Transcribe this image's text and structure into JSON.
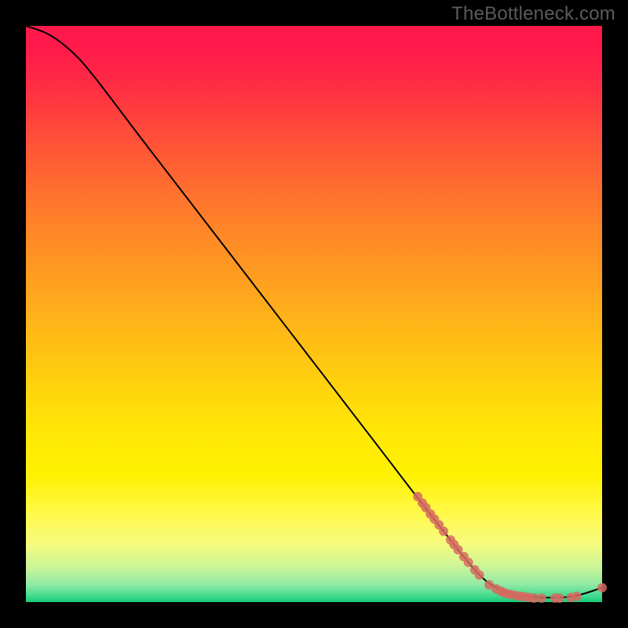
{
  "watermark": "TheBottleneck.com",
  "colors": {
    "background": "#000000",
    "curve_stroke": "#000000",
    "marker_fill": "#d66a60",
    "marker_stroke": "#d66a60",
    "gradient_top": "#ff1a4b",
    "gradient_bottom": "#15c97a"
  },
  "chart_data": {
    "type": "line",
    "title": "",
    "xlabel": "",
    "ylabel": "",
    "x_range": [
      0,
      100
    ],
    "y_range": [
      0,
      100
    ],
    "grid": false,
    "legend": false,
    "curve": [
      {
        "x": 0,
        "y": 100
      },
      {
        "x": 4,
        "y": 98.5
      },
      {
        "x": 8,
        "y": 95.5
      },
      {
        "x": 12,
        "y": 91
      },
      {
        "x": 20,
        "y": 80.5
      },
      {
        "x": 30,
        "y": 67.5
      },
      {
        "x": 40,
        "y": 54.5
      },
      {
        "x": 50,
        "y": 41.5
      },
      {
        "x": 60,
        "y": 28.5
      },
      {
        "x": 70,
        "y": 15.5
      },
      {
        "x": 78,
        "y": 5.5
      },
      {
        "x": 82,
        "y": 2.3
      },
      {
        "x": 85,
        "y": 1.2
      },
      {
        "x": 90,
        "y": 0.8
      },
      {
        "x": 95,
        "y": 1.0
      },
      {
        "x": 100,
        "y": 2.5
      }
    ],
    "markers": [
      {
        "x": 68.0,
        "y": 18.3
      },
      {
        "x": 68.8,
        "y": 17.2
      },
      {
        "x": 69.4,
        "y": 16.4
      },
      {
        "x": 70.2,
        "y": 15.3
      },
      {
        "x": 70.9,
        "y": 14.4
      },
      {
        "x": 71.7,
        "y": 13.4
      },
      {
        "x": 72.5,
        "y": 12.3
      },
      {
        "x": 73.7,
        "y": 10.8
      },
      {
        "x": 74.3,
        "y": 10.0
      },
      {
        "x": 75.0,
        "y": 9.1
      },
      {
        "x": 76.0,
        "y": 7.9
      },
      {
        "x": 76.8,
        "y": 6.9
      },
      {
        "x": 77.9,
        "y": 5.6
      },
      {
        "x": 78.7,
        "y": 4.7
      },
      {
        "x": 80.4,
        "y": 3.0
      },
      {
        "x": 81.6,
        "y": 2.3
      },
      {
        "x": 82.4,
        "y": 1.9
      },
      {
        "x": 83.0,
        "y": 1.6
      },
      {
        "x": 83.7,
        "y": 1.4
      },
      {
        "x": 84.3,
        "y": 1.3
      },
      {
        "x": 85.2,
        "y": 1.1
      },
      {
        "x": 85.9,
        "y": 1.0
      },
      {
        "x": 86.6,
        "y": 0.9
      },
      {
        "x": 87.4,
        "y": 0.8
      },
      {
        "x": 88.2,
        "y": 0.7
      },
      {
        "x": 89.5,
        "y": 0.7
      },
      {
        "x": 91.8,
        "y": 0.7
      },
      {
        "x": 92.6,
        "y": 0.7
      },
      {
        "x": 94.6,
        "y": 0.8
      },
      {
        "x": 95.6,
        "y": 1.0
      },
      {
        "x": 100.0,
        "y": 2.5
      }
    ]
  }
}
